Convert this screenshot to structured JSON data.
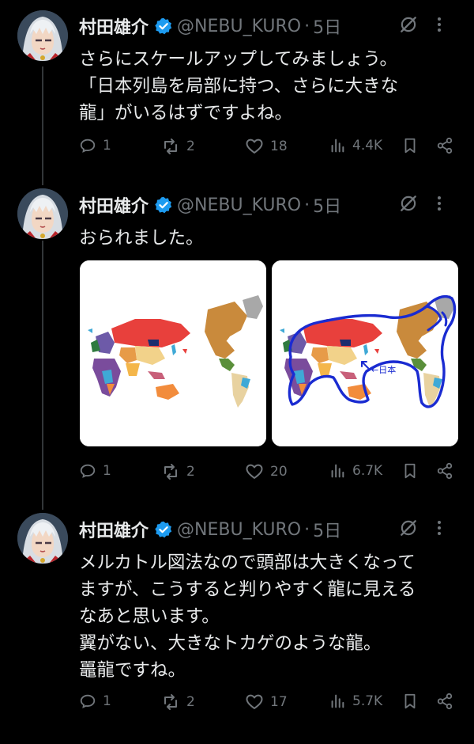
{
  "author": {
    "name": "村田雄介",
    "handle": "@NEBU_KURO",
    "separator": "·",
    "verified_color": "#1d9bf0"
  },
  "colors": {
    "background": "#000000",
    "text": "#e7e9ea",
    "muted": "#71767b",
    "dragon_outline": "#1a2bd1"
  },
  "tweets": [
    {
      "time": "5日",
      "text": "さらにスケールアップしてみましょう。\n「日本列島を局部に持つ、さらに大きな\n龍」がいるはずですよね。",
      "replies": "1",
      "reposts": "2",
      "likes": "18",
      "views": "4.4K"
    },
    {
      "time": "5日",
      "text": "おられました。",
      "media": [
        {
          "kind": "world-map",
          "annotation": ""
        },
        {
          "kind": "world-map-annotated",
          "annotation": "←日本"
        }
      ],
      "replies": "1",
      "reposts": "2",
      "likes": "20",
      "views": "6.7K"
    },
    {
      "time": "5日",
      "text": "メルカトル図法なので頭部は大きくなって\nますが、こうすると判りやすく龍に見える\nなあと思います。\n翼がない、大きなトカゲのような龍。\n鼉龍ですね。",
      "replies": "1",
      "reposts": "2",
      "likes": "17",
      "views": "5.7K"
    }
  ],
  "icons": {
    "reply": "reply-icon",
    "repost": "repost-icon",
    "like": "heart-icon",
    "views": "views-icon",
    "bookmark": "bookmark-icon",
    "share": "share-icon",
    "grok": "grok-icon",
    "more": "more-icon"
  }
}
